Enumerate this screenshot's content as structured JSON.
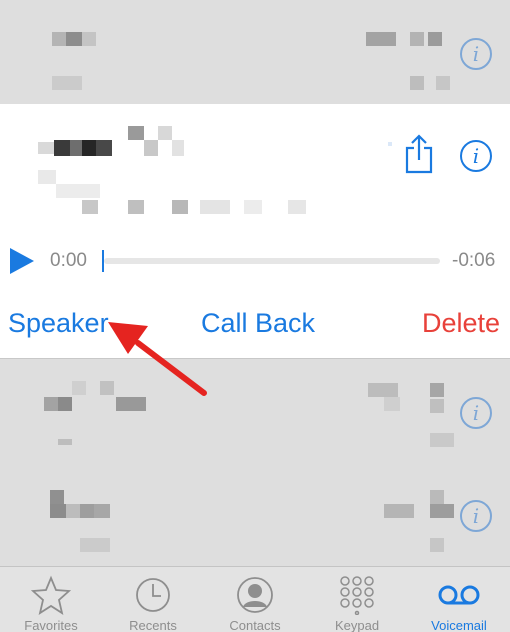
{
  "player": {
    "current_time": "0:00",
    "remaining_time": "-0:06",
    "progress": 0.0
  },
  "actions": {
    "speaker": "Speaker",
    "call_back": "Call Back",
    "delete": "Delete"
  },
  "tabbar": {
    "tabs": [
      {
        "label": "Favorites",
        "icon": "star-icon",
        "active": false
      },
      {
        "label": "Recents",
        "icon": "clock-icon",
        "active": false
      },
      {
        "label": "Contacts",
        "icon": "contacts-icon",
        "active": false
      },
      {
        "label": "Keypad",
        "icon": "keypad-icon",
        "active": false
      },
      {
        "label": "Voicemail",
        "icon": "voicemail-icon",
        "active": true
      }
    ]
  },
  "colors": {
    "accent": "#1a7ae0",
    "destructive": "#e8413a",
    "annotation_arrow": "#e52420"
  }
}
